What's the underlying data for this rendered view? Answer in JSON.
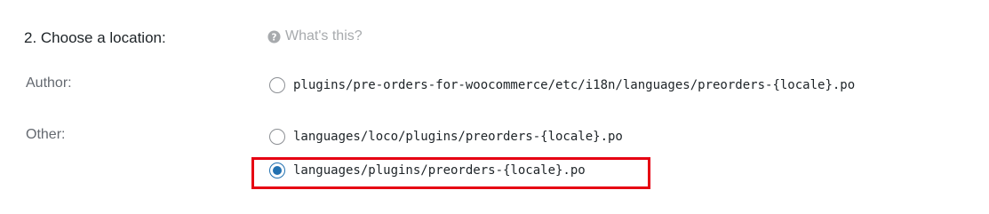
{
  "section": {
    "heading": "2. Choose a location:",
    "help_text": "What's this?",
    "help_icon": "question-circle-icon"
  },
  "rows": {
    "author": {
      "label": "Author:",
      "options": [
        {
          "path": "plugins/pre-orders-for-woocommerce/etc/i18n/languages/preorders-{locale}.po",
          "checked": false
        }
      ]
    },
    "other": {
      "label": "Other:",
      "options": [
        {
          "path": "languages/loco/plugins/preorders-{locale}.po",
          "checked": false
        },
        {
          "path": "languages/plugins/preorders-{locale}.po",
          "checked": true
        }
      ]
    }
  },
  "colors": {
    "accent": "#2271b1",
    "highlight_border": "#e60012",
    "help_text": "#a7aaad",
    "label_text": "#646970"
  }
}
